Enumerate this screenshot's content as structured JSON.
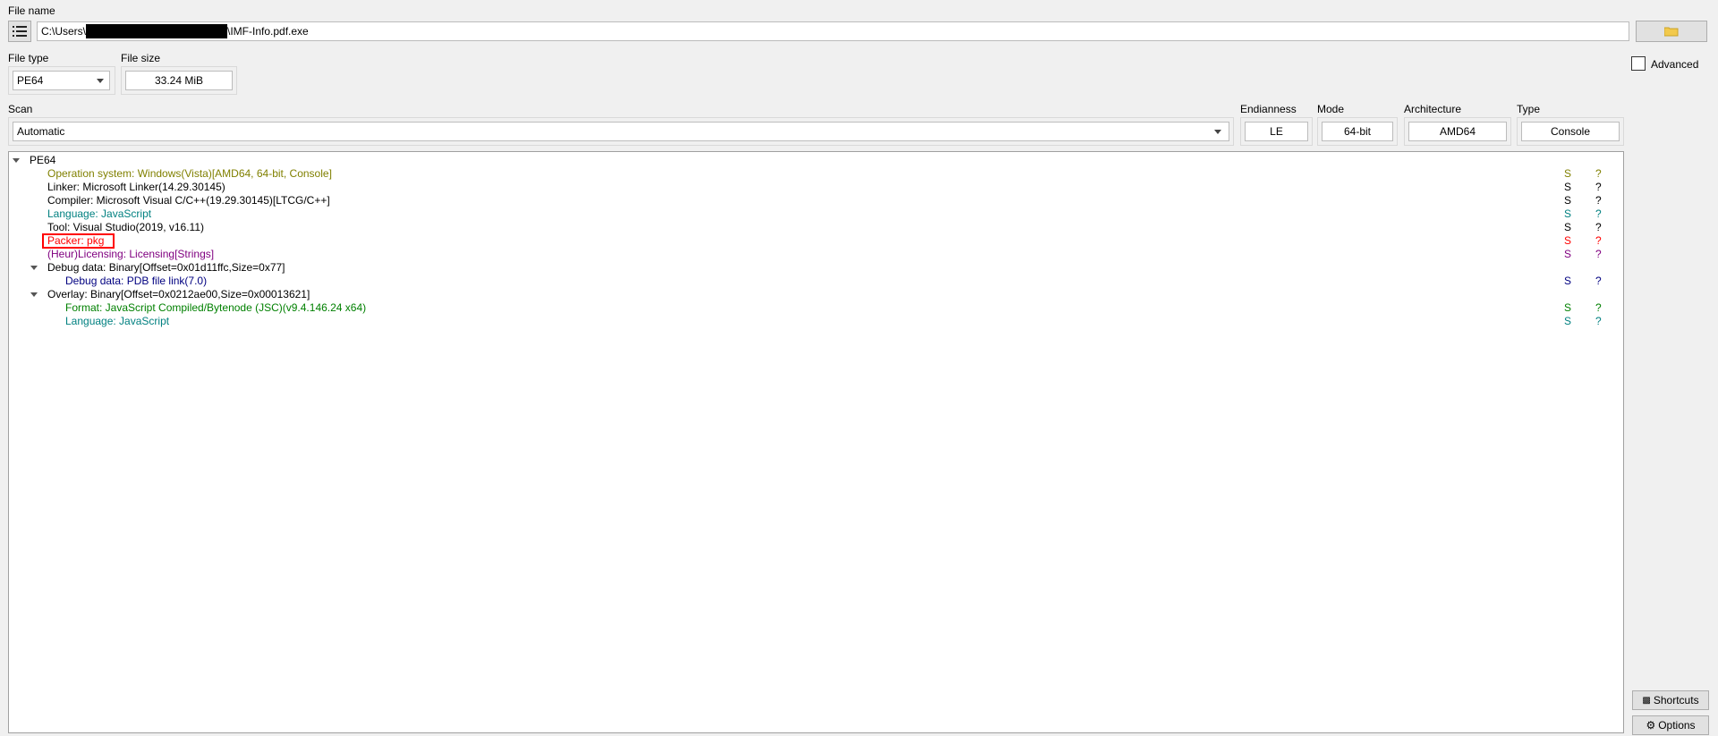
{
  "file": {
    "name_label": "File name",
    "path_prefix": "C:\\Users\\",
    "path_suffix": "\\IMF-Info.pdf.exe"
  },
  "file_type": {
    "label": "File type",
    "value": "PE64"
  },
  "file_size": {
    "label": "File size",
    "value": "33.24 MiB"
  },
  "scan": {
    "label": "Scan",
    "value": "Automatic"
  },
  "endianness": {
    "label": "Endianness",
    "value": "LE"
  },
  "mode": {
    "label": "Mode",
    "value": "64-bit"
  },
  "architecture": {
    "label": "Architecture",
    "value": "AMD64"
  },
  "type": {
    "label": "Type",
    "value": "Console"
  },
  "advanced_label": "Advanced",
  "shortcuts_label": "Shortcuts",
  "options_label": "Options",
  "colors": {
    "olive": "#808000",
    "black": "#000000",
    "teal": "#008080",
    "red": "#ff0000",
    "purple": "#800080",
    "navy": "#000080",
    "green": "#008000",
    "highlight_box": "#ff0000"
  },
  "tree": {
    "root": "PE64",
    "rows": [
      {
        "text": "Operation system: Windows(Vista)[AMD64, 64-bit, Console]",
        "s": "S",
        "q": "?",
        "color": "#808000"
      },
      {
        "text": "Linker: Microsoft Linker(14.29.30145)",
        "s": "S",
        "q": "?",
        "color": "#000000"
      },
      {
        "text": "Compiler: Microsoft Visual C/C++(19.29.30145)[LTCG/C++]",
        "s": "S",
        "q": "?",
        "color": "#000000"
      },
      {
        "text": "Language: JavaScript",
        "s": "S",
        "q": "?",
        "color": "#008080"
      },
      {
        "text": "Tool: Visual Studio(2019, v16.11)",
        "s": "S",
        "q": "?",
        "color": "#000000"
      },
      {
        "text": "Packer: pkg",
        "s": "S",
        "q": "?",
        "color": "#ff0000"
      },
      {
        "text": "(Heur)Licensing: Licensing[Strings]",
        "s": "S",
        "q": "?",
        "color": "#800080"
      },
      {
        "text": "Debug data: Binary[Offset=0x01d11ffc,Size=0x77]",
        "color": "#000000"
      },
      {
        "text": "Debug data: PDB file link(7.0)",
        "s": "S",
        "q": "?",
        "color": "#000080"
      },
      {
        "text": "Overlay: Binary[Offset=0x0212ae00,Size=0x00013621]",
        "color": "#000000"
      },
      {
        "text": "Format: JavaScript Compiled/Bytenode (JSC)(v9.4.146.24 x64)",
        "s": "S",
        "q": "?",
        "color": "#008000"
      },
      {
        "text": "Language: JavaScript",
        "s": "S",
        "q": "?",
        "color": "#008080"
      }
    ]
  }
}
